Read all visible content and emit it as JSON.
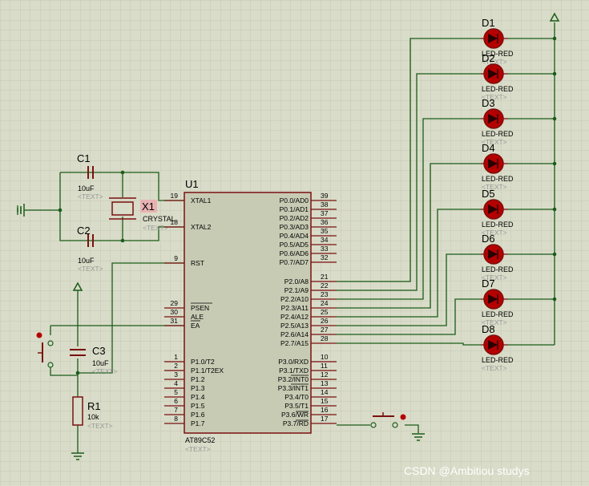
{
  "mcu": {
    "ref": "U1",
    "part": "AT89C52",
    "text_tag": "<TEXT>",
    "left_pins": [
      {
        "num": "19",
        "name": "XTAL1"
      },
      {
        "num": "18",
        "name": "XTAL2"
      },
      {
        "num": "9",
        "name": "RST"
      },
      {
        "num": "29",
        "name": "PSEN"
      },
      {
        "num": "30",
        "name": "ALE"
      },
      {
        "num": "31",
        "name": "EA"
      },
      {
        "num": "1",
        "name": "P1.0/T2"
      },
      {
        "num": "2",
        "name": "P1.1/T2EX"
      },
      {
        "num": "3",
        "name": "P1.2"
      },
      {
        "num": "4",
        "name": "P1.3"
      },
      {
        "num": "5",
        "name": "P1.4"
      },
      {
        "num": "6",
        "name": "P1.5"
      },
      {
        "num": "7",
        "name": "P1.6"
      },
      {
        "num": "8",
        "name": "P1.7"
      }
    ],
    "right_pins": [
      {
        "num": "39",
        "name": "P0.0/AD0"
      },
      {
        "num": "38",
        "name": "P0.1/AD1"
      },
      {
        "num": "37",
        "name": "P0.2/AD2"
      },
      {
        "num": "36",
        "name": "P0.3/AD3"
      },
      {
        "num": "35",
        "name": "P0.4/AD4"
      },
      {
        "num": "34",
        "name": "P0.5/AD5"
      },
      {
        "num": "33",
        "name": "P0.6/AD6"
      },
      {
        "num": "32",
        "name": "P0.7/AD7"
      },
      {
        "num": "21",
        "name": "P2.0/A8"
      },
      {
        "num": "22",
        "name": "P2.1/A9"
      },
      {
        "num": "23",
        "name": "P2.2/A10"
      },
      {
        "num": "24",
        "name": "P2.3/A11"
      },
      {
        "num": "25",
        "name": "P2.4/A12"
      },
      {
        "num": "26",
        "name": "P2.5/A13"
      },
      {
        "num": "27",
        "name": "P2.6/A14"
      },
      {
        "num": "28",
        "name": "P2.7/A15"
      },
      {
        "num": "10",
        "name": "P3.0/RXD"
      },
      {
        "num": "11",
        "name": "P3.1/TXD"
      },
      {
        "num": "12",
        "name": "P3.2/INT0"
      },
      {
        "num": "13",
        "name": "P3.3/INT1"
      },
      {
        "num": "14",
        "name": "P3.4/T0"
      },
      {
        "num": "15",
        "name": "P3.5/T1"
      },
      {
        "num": "16",
        "name": "P3.6/WR"
      },
      {
        "num": "17",
        "name": "P3.7/RD"
      }
    ]
  },
  "components": {
    "c1": {
      "ref": "C1",
      "value": "10uF",
      "tag": "<TEXT>"
    },
    "c2": {
      "ref": "C2",
      "value": "10uF",
      "tag": "<TEXT>"
    },
    "c3": {
      "ref": "C3",
      "value": "10uF",
      "tag": "<TEXT>"
    },
    "x1": {
      "ref": "X1",
      "value": "CRYSTAL",
      "tag": "<TEXT>"
    },
    "r1": {
      "ref": "R1",
      "value": "10k",
      "tag": "<TEXT>"
    }
  },
  "leds": [
    {
      "ref": "D1",
      "value": "LED-RED",
      "tag": "<TEXT>"
    },
    {
      "ref": "D2",
      "value": "LED-RED",
      "tag": "<TEXT>"
    },
    {
      "ref": "D3",
      "value": "LED-RED",
      "tag": "<TEXT>"
    },
    {
      "ref": "D4",
      "value": "LED-RED",
      "tag": "<TEXT>"
    },
    {
      "ref": "D5",
      "value": "LED-RED",
      "tag": "<TEXT>"
    },
    {
      "ref": "D6",
      "value": "LED-RED",
      "tag": "<TEXT>"
    },
    {
      "ref": "D7",
      "value": "LED-RED",
      "tag": "<TEXT>"
    },
    {
      "ref": "D8",
      "value": "LED-RED",
      "tag": "<TEXT>"
    }
  ],
  "watermark": "CSDN @Ambitiou  studys",
  "colors": {
    "background": "#d9dcc8",
    "grid": "#c4c7b3",
    "wire": "#1a5c1a",
    "component": "#7a1010",
    "chip_fill": "#c8cbb4",
    "led_fill": "#b50000",
    "pin_dot": "#8a1a1a"
  }
}
